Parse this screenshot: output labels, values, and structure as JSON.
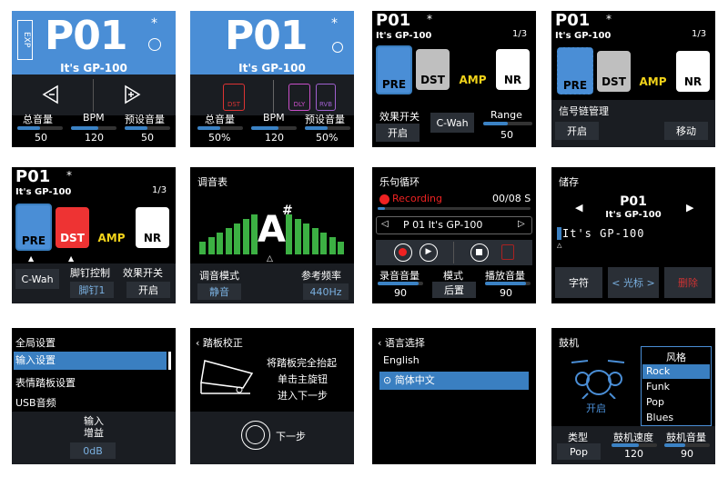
{
  "s1": {
    "patch": "P01",
    "name": "It's GP-100",
    "exp": "EXP",
    "star": "*",
    "labels": [
      "总音量",
      "BPM",
      "预设音量"
    ],
    "values": [
      "50",
      "120",
      "50"
    ],
    "levels": [
      0.5,
      0.6,
      0.5
    ]
  },
  "s2": {
    "patch": "P01",
    "name": "It's GP-100",
    "star": "*",
    "icons": [
      "DST",
      "DLY",
      "RVB"
    ],
    "labels": [
      "总音量",
      "BPM",
      "预设音量"
    ],
    "values": [
      "50%",
      "120",
      "50%"
    ],
    "levels": [
      0.5,
      0.6,
      0.5
    ]
  },
  "s3": {
    "patch": "P01",
    "name": "It's GP-100",
    "star": "*",
    "page": "1/3",
    "fx": [
      "PRE",
      "DST",
      "AMP",
      "NR"
    ],
    "fx_colors": [
      "#4a8ed6",
      "#bfbfbf",
      "#f2d31a",
      "#ffffff"
    ],
    "switch_label": "效果开关",
    "switch_value": "开启",
    "param_btn": "C-Wah",
    "range_label": "Range",
    "range_value": "50",
    "range_level": 0.5
  },
  "s4": {
    "patch": "P01",
    "name": "It's GP-100",
    "star": "*",
    "page": "1/3",
    "fx": [
      "PRE",
      "DST",
      "AMP",
      "NR"
    ],
    "title": "信号链管理",
    "btn_on": "开启",
    "btn_move": "移动"
  },
  "s5": {
    "patch": "P01",
    "name": "It's GP-100",
    "star": "*",
    "page": "1/3",
    "fx": [
      "PRE",
      "DST",
      "AMP",
      "NR"
    ],
    "fx_colors": [
      "#4a8ed6",
      "#e33",
      "#f2d31a",
      "#ffffff"
    ],
    "param_btn": "C-Wah",
    "foot_label": "脚钉控制",
    "foot_value": "脚钉1",
    "switch_label": "效果开关",
    "switch_value": "开启"
  },
  "s6": {
    "title": "调音表",
    "note": "A",
    "sharp": "#",
    "mode_label": "调音模式",
    "mode_value": "静音",
    "ref_label": "参考频率",
    "ref_value": "440Hz"
  },
  "s7": {
    "title": "乐句循环",
    "status": "Recording",
    "time": "00/08 S",
    "patch_name": "P 01  It's GP-100",
    "rec_vol_label": "录音音量",
    "rec_vol": "90",
    "mode_label": "模式",
    "mode_value": "后置",
    "play_vol_label": "播放音量",
    "play_vol": "90",
    "progress": 0.05
  },
  "s8": {
    "title": "储存",
    "patch": "P01",
    "name": "It's GP-100",
    "edit_text": "It's GP-100",
    "btn_char": "字符",
    "btn_cursor": "光标",
    "btn_delete": "删除",
    "cursor_arrows": [
      "<",
      ">"
    ]
  },
  "s9": {
    "items": [
      "全局设置",
      "输入设置",
      "表情踏板设置",
      "USB音频"
    ],
    "sub_label": "输入\n增益",
    "sub_label_1": "输入",
    "sub_label_2": "增益",
    "sub_value": "0dB"
  },
  "s10": {
    "title": "踏板校正",
    "instr": [
      "将踏板完全抬起",
      "单击主旋钮",
      "进入下一步"
    ],
    "next": "下一步"
  },
  "s11": {
    "title": "语言选择",
    "options": [
      "English",
      "简体中文"
    ]
  },
  "s12": {
    "title": "鼓机",
    "on": "开启",
    "style_title": "风格",
    "styles": [
      "Rock",
      "Funk",
      "Pop",
      "Blues"
    ],
    "type_label": "类型",
    "type_value": "Pop",
    "speed_label": "鼓机速度",
    "speed_value": "120",
    "vol_label": "鼓机音量",
    "vol_value": "90",
    "speed_level": 0.6,
    "vol_level": 0.45
  }
}
